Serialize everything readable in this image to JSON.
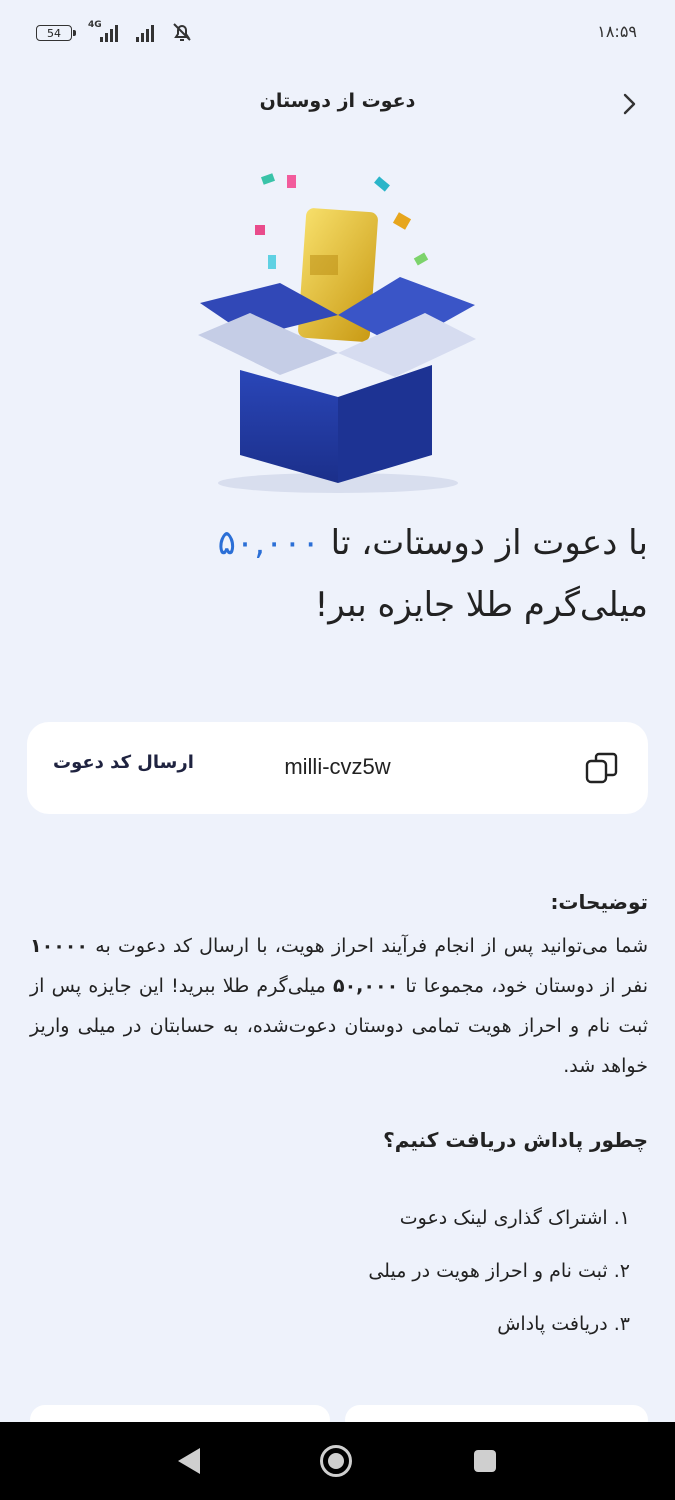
{
  "status": {
    "battery": "54",
    "network": "4G",
    "time": "۱۸:۵۹"
  },
  "header": {
    "title": "دعوت از دوستان"
  },
  "hero": {
    "line1_prefix": "با دعوت از دوستات، تا ",
    "amount": "۵۰,۰۰۰",
    "line2": "میلی‌گرم طلا جایزه ببر!"
  },
  "invite": {
    "code": "milli-cvz5w",
    "send_label": "ارسال کد دعوت"
  },
  "description": {
    "title": "توضیحات:",
    "text_before": "شما می‌توانید پس از انجام فرآیند احراز هویت، با ارسال کد دعوت به ",
    "count": "۱۰۰۰۰",
    "text_middle": " نفر از دوستان خود، مجموعا تا ",
    "amount": "۵۰,۰۰۰",
    "text_after": " میلی‌گرم طلا ببرید! این جایزه پس از ثبت نام و احراز هویت تمامی دوستان دعوت‌شده، به حسابتان در میلی واریز خواهد شد."
  },
  "how": {
    "title": "چطور پاداش دریافت کنیم؟",
    "steps": [
      "۱. اشتراک گذاری لینک دعوت",
      "۲. ثبت نام و احراز هویت در میلی",
      "۳. دریافت پاداش"
    ]
  }
}
